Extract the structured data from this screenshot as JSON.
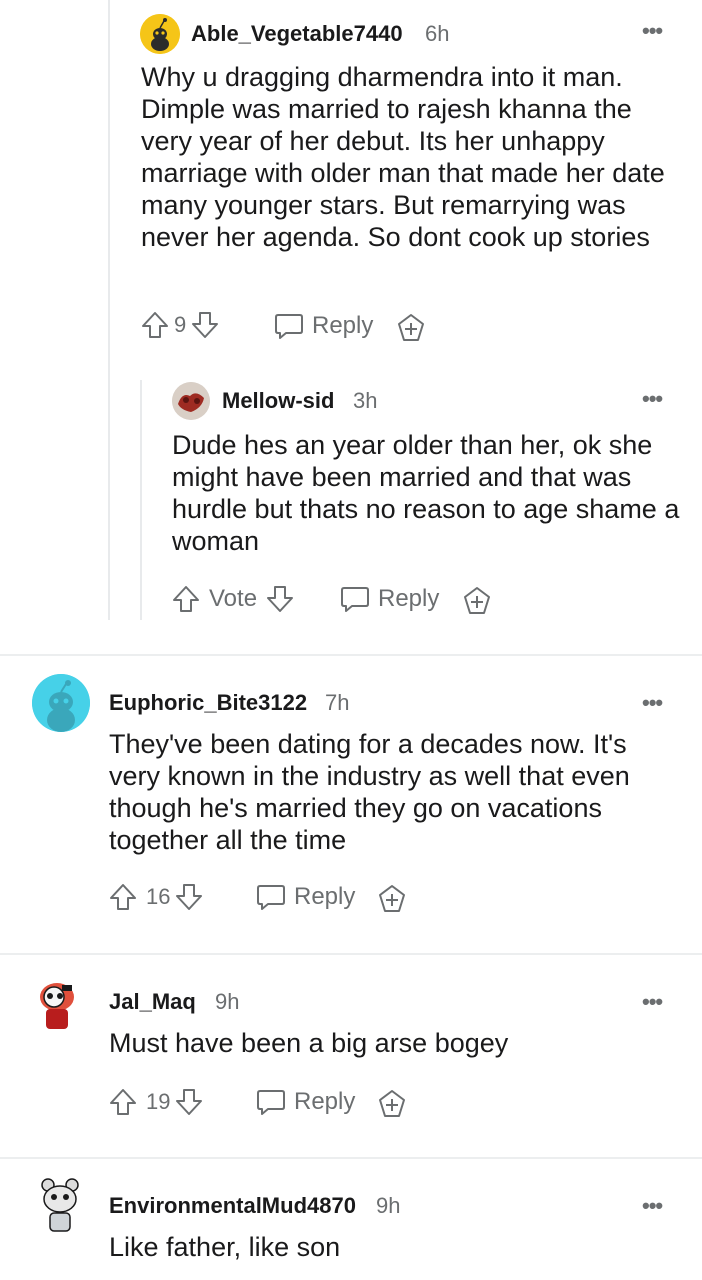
{
  "comments": [
    {
      "username": "Able_Vegetable7440",
      "time": "6h",
      "body": "Why u dragging dharmendra into it man. Dimple was married to rajesh khanna the very year of her debut. Its her unhappy marriage with older man that made her date many younger stars. But remarrying was never her agenda. So dont cook up stories",
      "votes": "9",
      "reply_label": "Reply",
      "avatar_color": "#f5c518"
    },
    {
      "username": "Mellow-sid",
      "time": "3h",
      "body": "Dude hes an year older than her, ok she might have been married and that was hurdle but thats no reason to age shame a woman",
      "votes": "Vote",
      "reply_label": "Reply",
      "avatar_color": "#8a3a2a"
    },
    {
      "username": "Euphoric_Bite3122",
      "time": "7h",
      "body": "They've been dating for a decades now. It's very known in the industry as well that even though he's married they go on vacations together all the time",
      "votes": "16",
      "reply_label": "Reply",
      "avatar_color": "#46d1e8"
    },
    {
      "username": "Jal_Maq",
      "time": "9h",
      "body": "Must have been a big arse bogey",
      "votes": "19",
      "reply_label": "Reply",
      "avatar_color": "#e0503c"
    },
    {
      "username": "EnvironmentalMud4870",
      "time": "9h",
      "body": "Like father, like son",
      "avatar_color": "#9aa0a6"
    }
  ],
  "more_glyph": "•••",
  "colors": {
    "meta": "#6b6e70",
    "separator": "#eceeef",
    "thread_line": "#e8eaec"
  }
}
